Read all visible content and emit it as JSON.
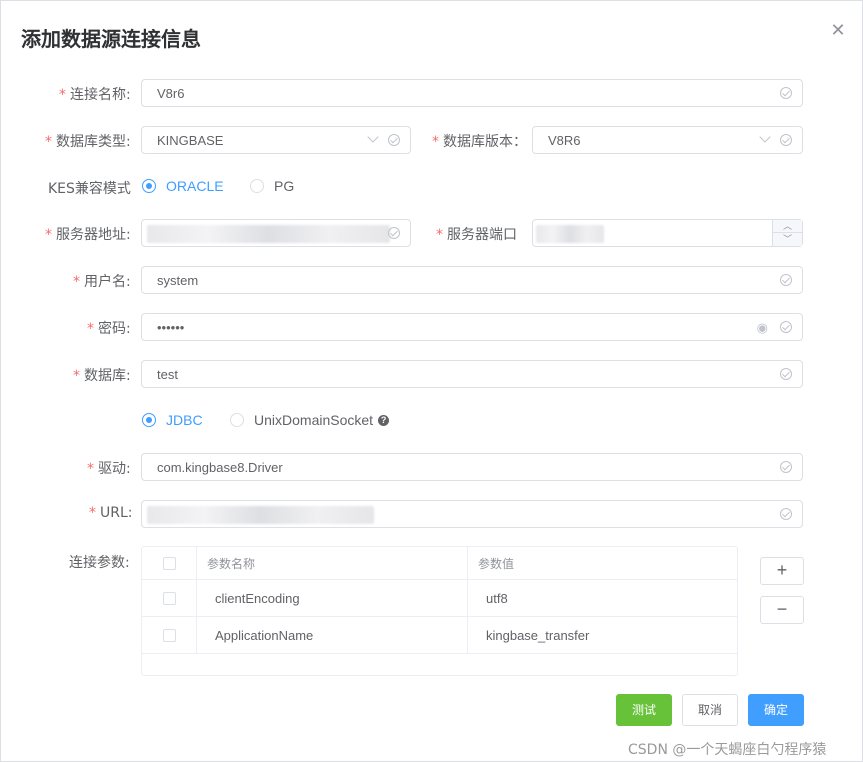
{
  "dialog": {
    "title": "添加数据源连接信息"
  },
  "form": {
    "conn_name": {
      "label": "连接名称:",
      "value": "V8r6"
    },
    "db_type": {
      "label": "数据库类型:",
      "value": "KINGBASE"
    },
    "db_version": {
      "label": "数据库版本：",
      "value": "V8R6"
    },
    "kes_mode": {
      "label": "KES兼容模式",
      "options": [
        "ORACLE",
        "PG"
      ],
      "selected": "ORACLE"
    },
    "server_addr": {
      "label": "服务器地址:"
    },
    "server_port": {
      "label": "服务器端口"
    },
    "username": {
      "label": "用户名:",
      "value": "system"
    },
    "password": {
      "label": "密码:",
      "value": "••••••"
    },
    "database": {
      "label": "数据库:",
      "value": "test"
    },
    "conn_type": {
      "options": [
        "JDBC",
        "UnixDomainSocket"
      ],
      "selected": "JDBC"
    },
    "driver": {
      "label": "驱动:",
      "value": "com.kingbase8.Driver"
    },
    "url": {
      "label": "URL:"
    },
    "params": {
      "label": "连接参数:"
    }
  },
  "params_table": {
    "columns": [
      "参数名称",
      "参数值"
    ],
    "rows": [
      {
        "name": "clientEncoding",
        "value": "utf8"
      },
      {
        "name": "ApplicationName",
        "value": "kingbase_transfer"
      }
    ]
  },
  "buttons": {
    "add": "+",
    "remove": "−",
    "test": "测试",
    "cancel": "取消",
    "ok": "确定"
  },
  "icons": {
    "close": "close-icon",
    "check": "circle-check-icon",
    "chevron": "chevron-down-icon",
    "eye": "eye-icon",
    "help": "question-circle-icon"
  },
  "colors": {
    "primary": "#409eff",
    "success": "#67c23a",
    "required": "#f56c6c"
  },
  "watermark": "CSDN @一个天蝎座白勺程序猿"
}
